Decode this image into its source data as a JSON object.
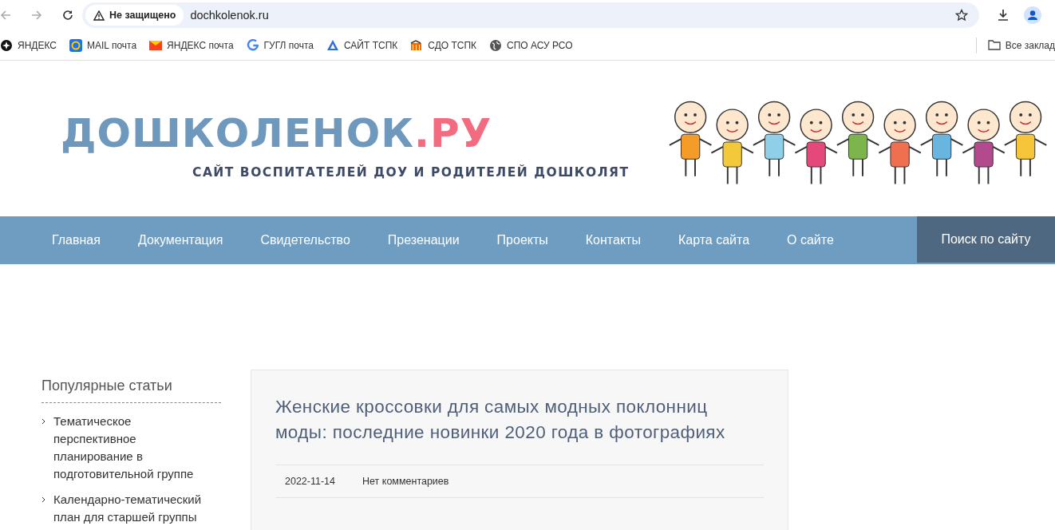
{
  "browser": {
    "security": "Не защищено",
    "url": "dochkolenok.ru",
    "bookmarks": [
      {
        "label": "ЯНДЕКС",
        "kind": "star"
      },
      {
        "label": "MAIL почта",
        "kind": "at"
      },
      {
        "label": "ЯНДЕКС почта",
        "kind": "mail"
      },
      {
        "label": "ГУГЛ почта",
        "kind": "g"
      },
      {
        "label": "САЙТ ТСПК",
        "kind": "triangle"
      },
      {
        "label": "СДО ТСПК",
        "kind": "m"
      },
      {
        "label": "СПО АСУ РСО",
        "kind": "globe"
      }
    ],
    "all_bookmarks": "Все заклад"
  },
  "header": {
    "logo": "ДОШКОЛЕНОК",
    "logo_suffix": ".РУ",
    "tagline": "САЙТ ВОСПИТАТЕЛЕЙ ДОУ И РОДИТЕЛЕЙ ДОШКОЛЯТ"
  },
  "nav": {
    "items": [
      "Главная",
      "Документация",
      "Свидетельство",
      "Презенации",
      "Проекты",
      "Контакты",
      "Карта сайта",
      "О сайте"
    ],
    "search": "Поиск по сайту"
  },
  "sidebar": {
    "title": "Популярные статьи",
    "items": [
      "Тематическое перспективное планирование в подготовительной группе",
      "Календарно-тематический план для старшей группы"
    ]
  },
  "article": {
    "title": "Женские кроссовки для самых модных поклонниц моды: последние новинки 2020 года в фотографиях",
    "date": "2022-11-14",
    "comments": "Нет комментариев"
  }
}
